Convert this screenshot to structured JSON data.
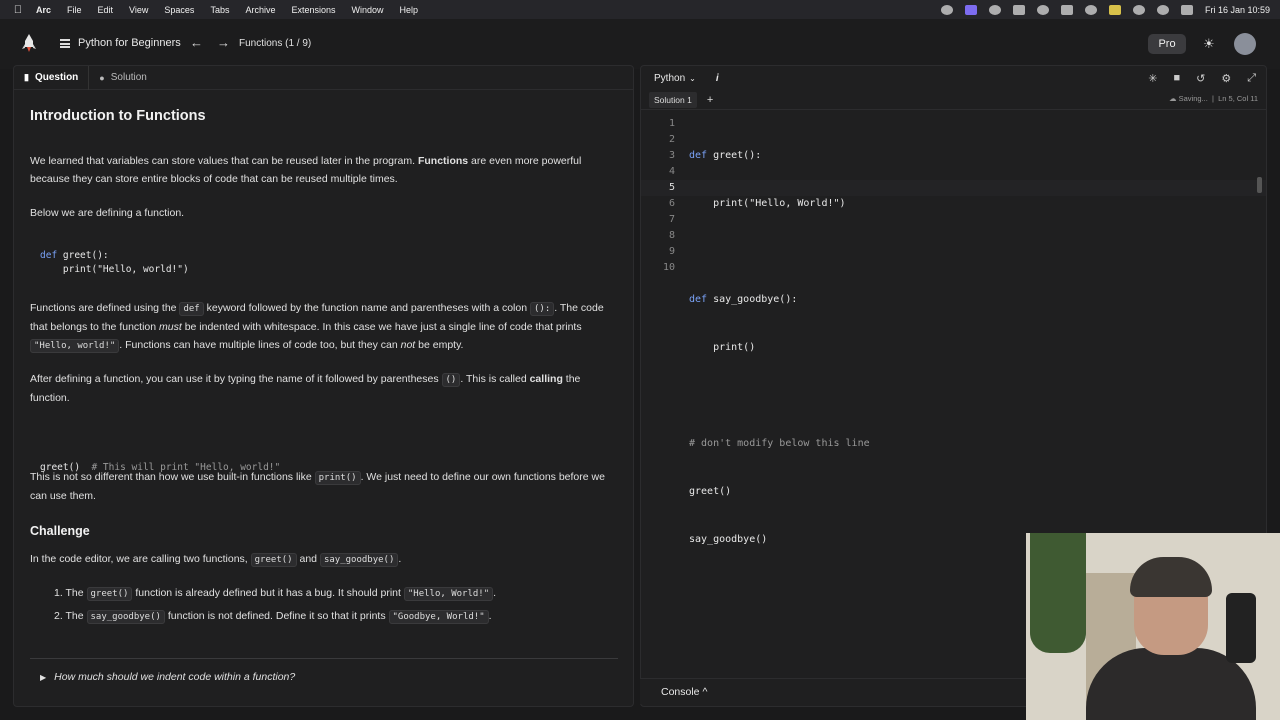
{
  "menubar": {
    "app": "Arc",
    "items": [
      "File",
      "Edit",
      "View",
      "Spaces",
      "Tabs",
      "Archive",
      "Extensions",
      "Window",
      "Help"
    ],
    "datetime": "Fri 16 Jan  10:59"
  },
  "topbar": {
    "course": "Python for Beginners",
    "lesson": "Functions (1 / 9)",
    "pro_label": "Pro"
  },
  "left": {
    "tabs": [
      "Question",
      "Solution"
    ],
    "title": "Introduction to Functions",
    "p1_a": "We learned that variables can store values that can be reused later in the program. ",
    "p1_b": "Functions",
    "p1_c": " are even more powerful because they can store entire blocks of code that can be reused multiple times.",
    "p2": "Below we are defining a function.",
    "code1_l1_kw": "def",
    "code1_l1_rest": " greet():",
    "code1_l2": "    print(\"Hello, world!\")",
    "p3_a": "Functions are defined using the ",
    "p3_def": "def",
    "p3_b": " keyword followed by the function name and parentheses with a colon ",
    "p3_colon": "():",
    "p3_c": ". The code that belongs to the function ",
    "p3_must": "must",
    "p3_d": " be indented with whitespace. In this case we have just a single line of code that prints ",
    "p3_hello": "\"Hello, world!\"",
    "p3_e": ". Functions can have multiple lines of code too, but they can ",
    "p3_not": "not",
    "p3_f": " be empty.",
    "p4_a": "After defining a function, you can use it by typing the name of it followed by parentheses ",
    "p4_paren": "()",
    "p4_b": ". This is called ",
    "p4_calling": "calling",
    "p4_c": " the function.",
    "code2_call": "greet()",
    "code2_comment": "  # This will print \"Hello, world!\"",
    "p5_a": "This is not so different than how we use built-in functions like ",
    "p5_print": "print()",
    "p5_b": ". We just need to define our own functions before we can use them.",
    "challenge_title": "Challenge",
    "c_intro_a": "In the code editor, we are calling two functions, ",
    "c_greet": "greet()",
    "c_and": " and ",
    "c_say": "say_goodbye()",
    "c_dot": ".",
    "li1_a": "1. The ",
    "li1_code": "greet()",
    "li1_b": " function is already defined but it has a bug. It should print ",
    "li1_str": "\"Hello, World!\"",
    "li1_c": ".",
    "li2_a": "2. The ",
    "li2_code": "say_goodbye()",
    "li2_b": " function is not defined. Define it so that it prints ",
    "li2_str": "\"Goodbye, World!\"",
    "li2_c": ".",
    "details": "How much should we indent code within a function?"
  },
  "editor": {
    "language": "Python",
    "info": "i",
    "solution_tab": "Solution 1",
    "status_saving": "Saving...",
    "status_pos": "Ln 5, Col 11",
    "line_numbers": [
      "1",
      "2",
      "3",
      "4",
      "5",
      "6",
      "7",
      "8",
      "9",
      "10"
    ],
    "lines": [
      "def greet():",
      "    print(\"Hello, World!\")",
      "",
      "def say_goodbye():",
      "    print()",
      "",
      "# don't modify below this line",
      "greet()",
      "say_goodbye()",
      ""
    ],
    "console_label": "Console ^"
  }
}
